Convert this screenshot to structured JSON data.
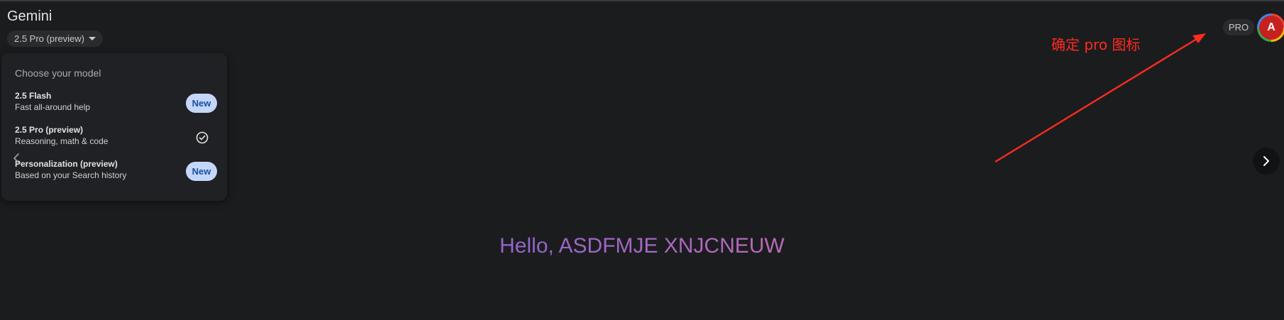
{
  "app": {
    "title": "Gemini"
  },
  "model_selector": {
    "current": "2.5 Pro (preview)"
  },
  "model_menu": {
    "heading": "Choose your model",
    "items": [
      {
        "title": "2.5 Flash",
        "subtitle": "Fast all-around help",
        "badge": "New",
        "selected": false
      },
      {
        "title": "2.5 Pro (preview)",
        "subtitle": "Reasoning, math & code",
        "badge": "",
        "selected": true
      },
      {
        "title": "Personalization (preview)",
        "subtitle": "Based on your Search history",
        "badge": "New",
        "selected": false
      }
    ]
  },
  "header": {
    "plan_badge": "PRO",
    "avatar_initial": "A"
  },
  "annotation": {
    "text": "确定 pro 图标",
    "color": "#ff2b21"
  },
  "greeting": {
    "text": "Hello, ASDFMJE XNJCNEUW"
  },
  "icons": {
    "dropdown": "caret-down-icon",
    "selected": "check-circle-icon",
    "prev": "chevron-left-icon",
    "next": "chevron-right-icon"
  },
  "colors": {
    "background": "#1b1c1e",
    "badge_bg": "#c4d7fb",
    "badge_text": "#1b4f9e",
    "avatar": "#c5221f",
    "gradient": [
      "#4f86f7",
      "#7d63d6",
      "#b96ab8",
      "#dd5f72"
    ]
  }
}
